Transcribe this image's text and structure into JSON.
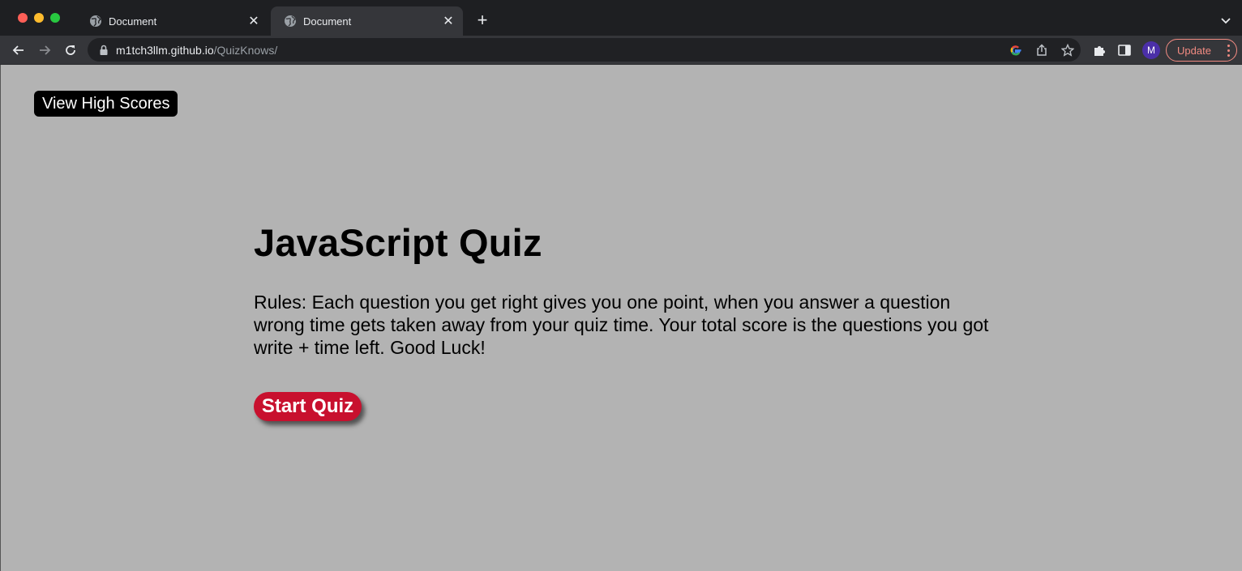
{
  "browser": {
    "tabs": [
      {
        "title": "Document",
        "close": "✕"
      },
      {
        "title": "Document",
        "close": "✕"
      }
    ],
    "new_tab": "+",
    "url_host": "m1tch3llm.github.io",
    "url_path": "/QuizKnows/",
    "profile_initial": "M",
    "update_label": "Update",
    "icons": [
      "globe-icon",
      "close-icon",
      "plus-icon",
      "chevron-down-icon",
      "back-arrow-icon",
      "forward-arrow-icon",
      "reload-icon",
      "lock-icon",
      "google-icon",
      "share-icon",
      "star-icon",
      "puzzle-icon",
      "sidebar-icon",
      "kebab-icon"
    ],
    "colors": {
      "tabbar": "#1e1f22",
      "toolbar": "#35363a",
      "omnibox": "#202124",
      "update_accent": "#f28b82",
      "avatar": "#4b2fa8"
    }
  },
  "page": {
    "high_scores_label": "View High Scores",
    "title": "JavaScript Quiz",
    "rules": "Rules: Each question you get right gives you one point, when you answer a question wrong time gets taken away from your quiz time. Your total score is the questions you got write + time left. Good Luck!",
    "start_label": "Start Quiz",
    "colors": {
      "background": "#b3b3b3",
      "start_button": "#c8102e",
      "high_scores_button": "#000000"
    }
  }
}
